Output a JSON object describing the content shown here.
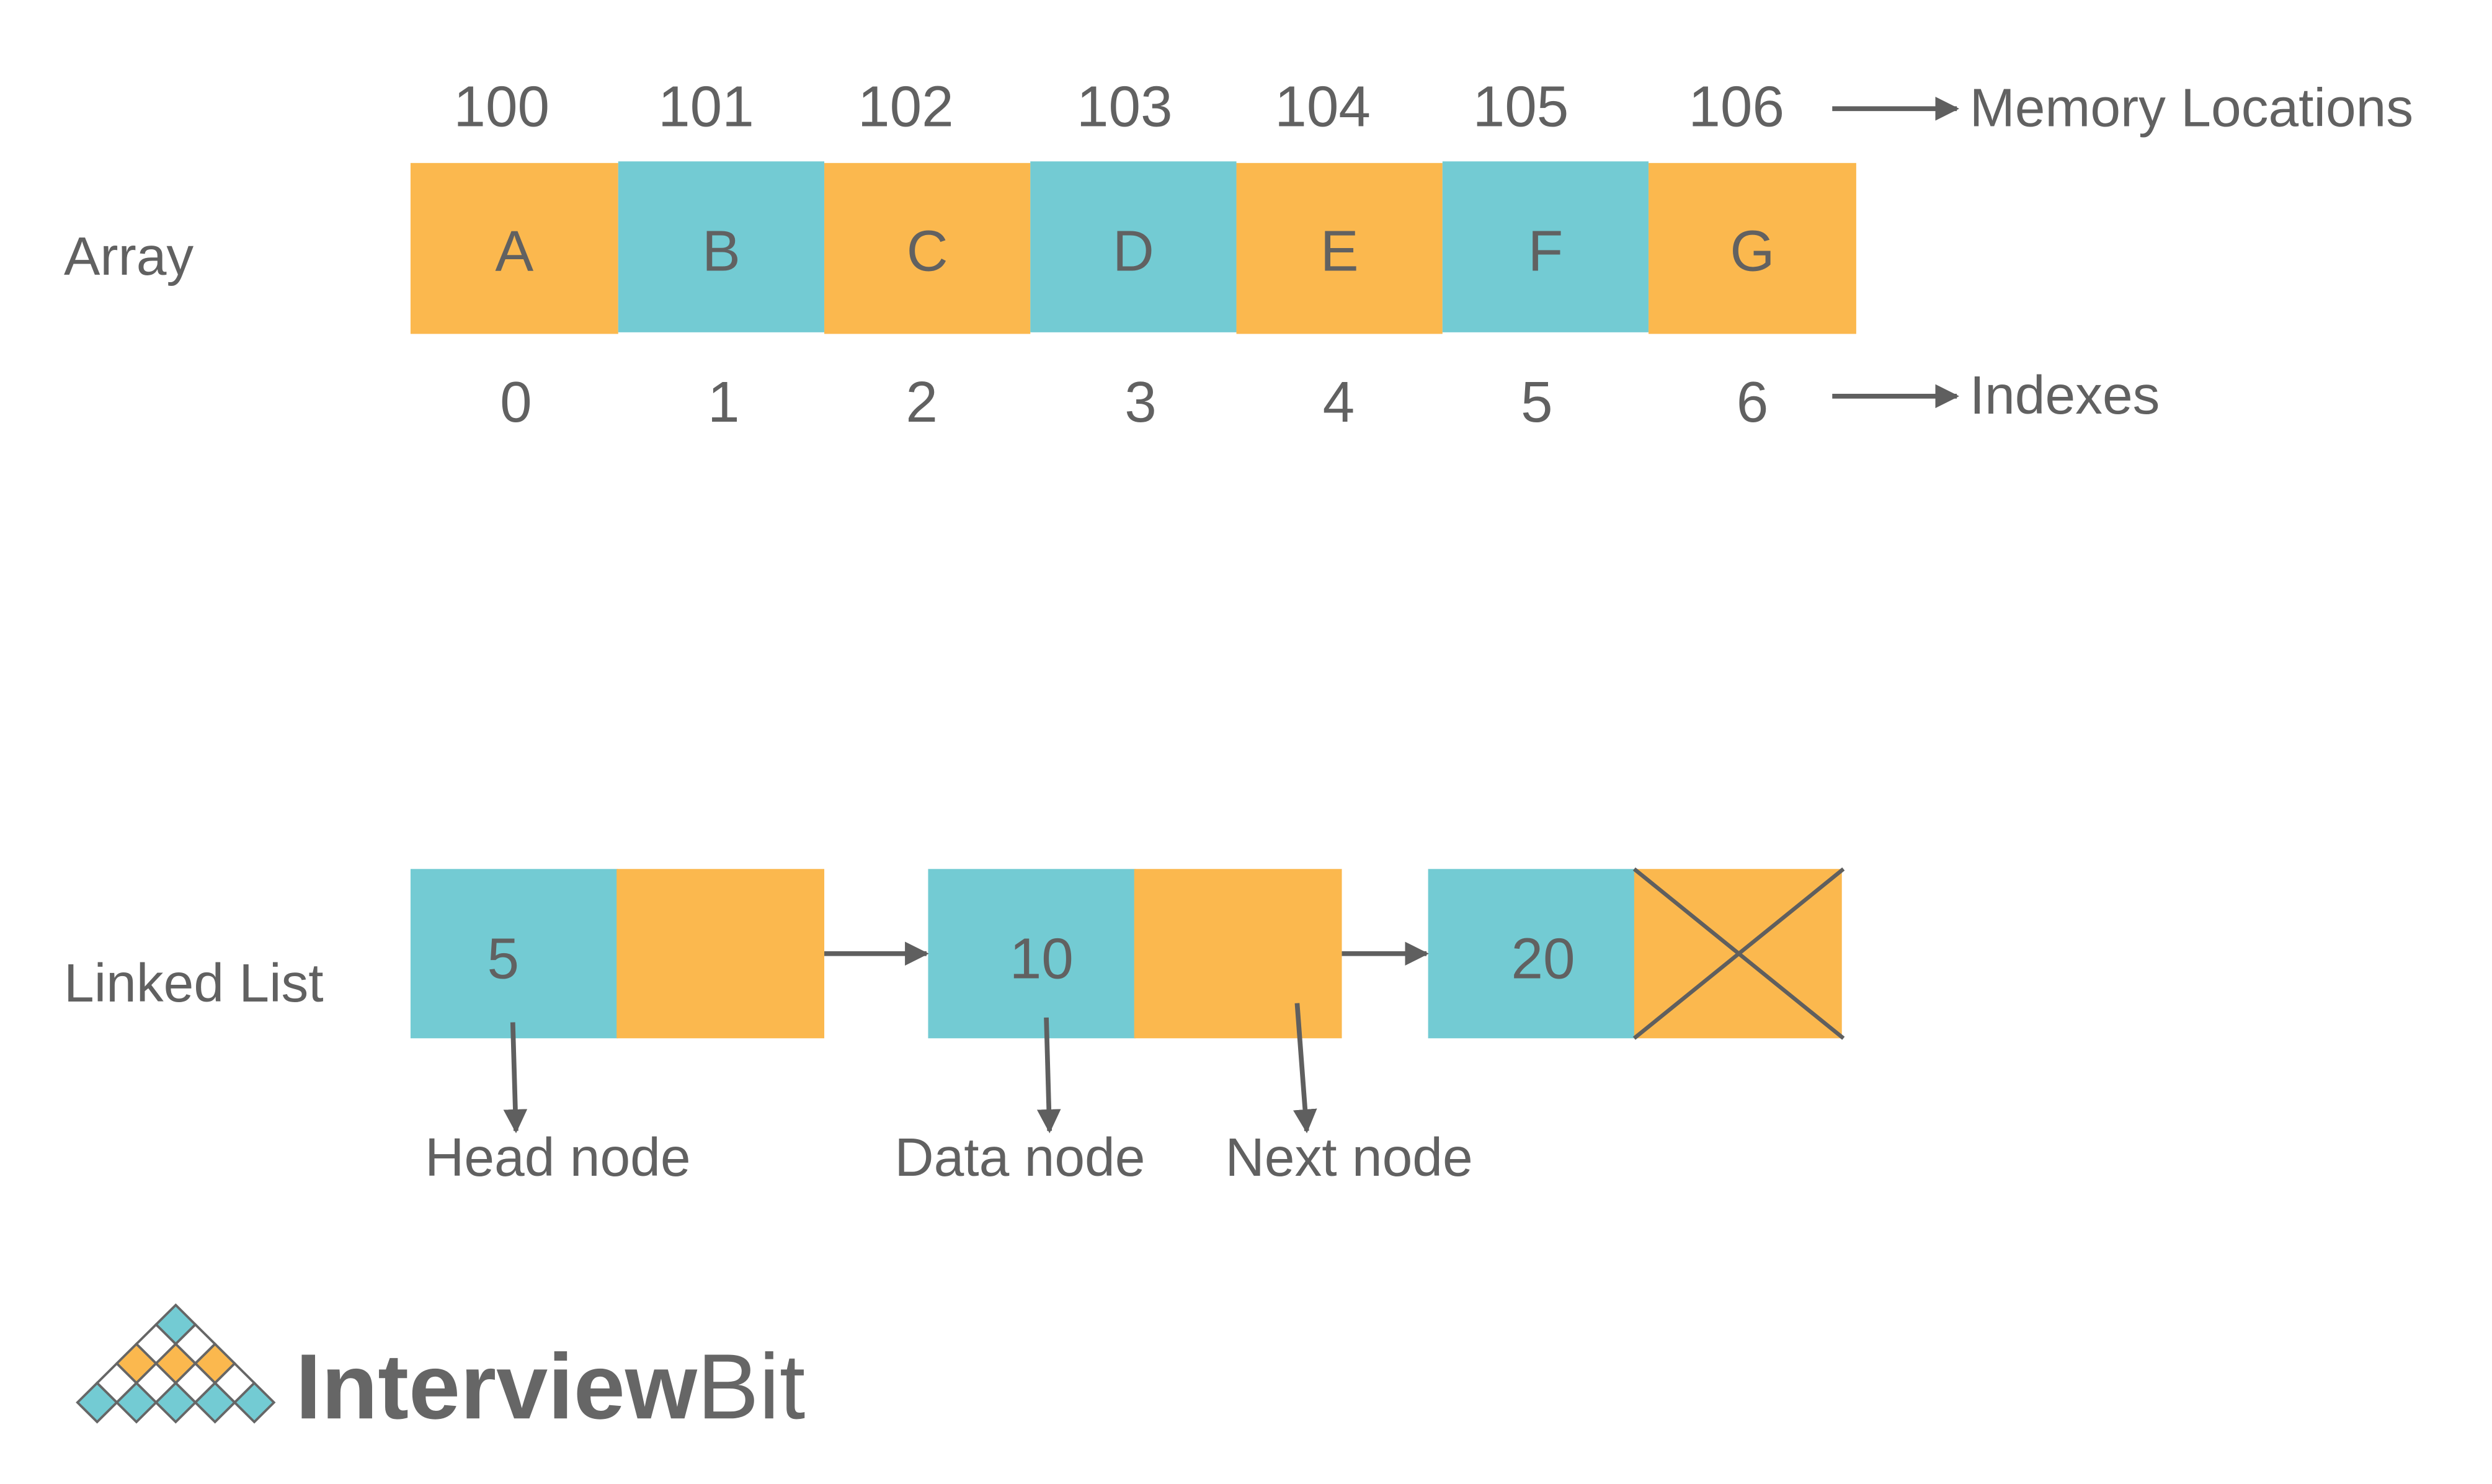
{
  "colors": {
    "orange": "#FBB84E",
    "teal": "#73CBD3",
    "text": "#616161",
    "line": "#5f5f5f"
  },
  "array": {
    "label": "Array",
    "cells": [
      "A",
      "B",
      "C",
      "D",
      "E",
      "F",
      "G"
    ],
    "cell_colors": [
      "orange",
      "teal",
      "orange",
      "teal",
      "orange",
      "teal",
      "orange"
    ],
    "memory_locations": [
      "100",
      "101",
      "102",
      "103",
      "104",
      "105",
      "106"
    ],
    "indexes": [
      "0",
      "1",
      "2",
      "3",
      "4",
      "5",
      "6"
    ],
    "memory_label": "Memory Locations",
    "indexes_label": "Indexes"
  },
  "linked_list": {
    "label": "Linked List",
    "nodes": [
      {
        "data": "5",
        "next": "pointer"
      },
      {
        "data": "10",
        "next": "pointer"
      },
      {
        "data": "20",
        "next": "null"
      }
    ],
    "annotations": [
      "Head node",
      "Data node",
      "Next node"
    ]
  },
  "logo": {
    "text_bold": "Interview",
    "text_light": "Bit"
  }
}
